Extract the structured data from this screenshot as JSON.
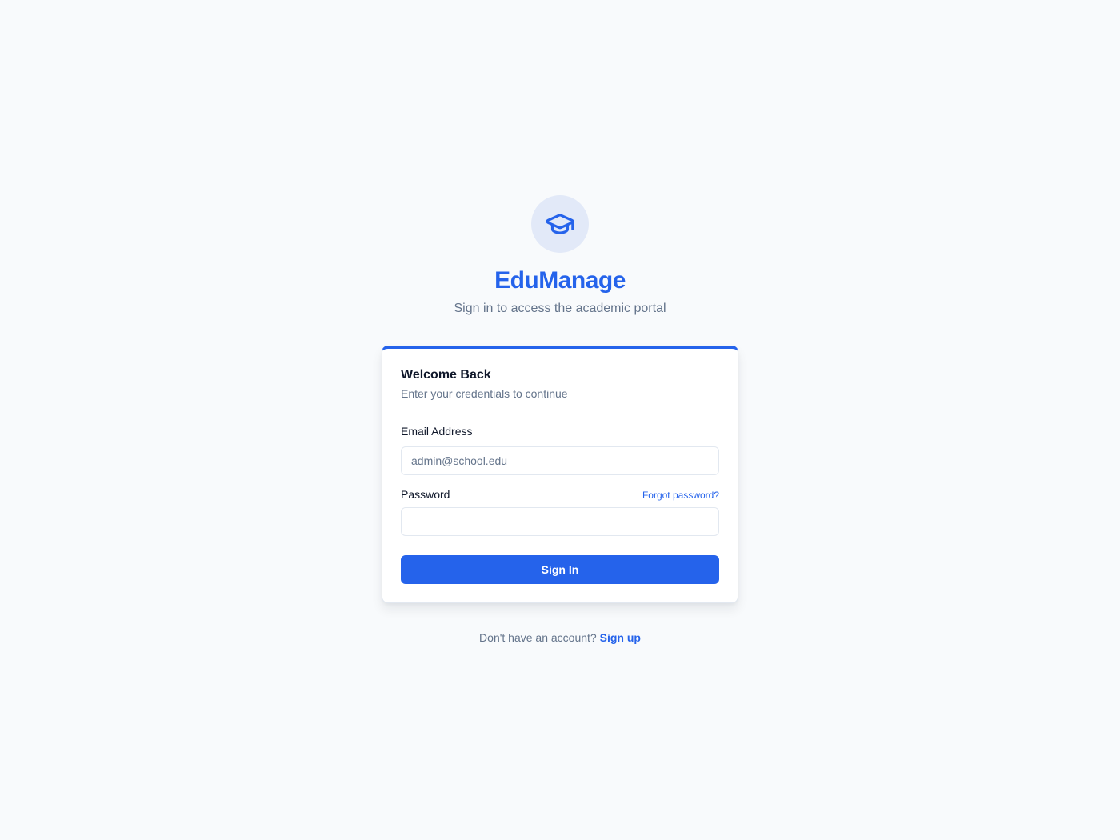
{
  "brand": {
    "icon": "graduation-cap-icon",
    "title": "EduManage",
    "subtitle": "Sign in to access the academic portal"
  },
  "login_card": {
    "heading": "Welcome Back",
    "subheading": "Enter your credentials to continue",
    "email": {
      "label": "Email Address",
      "placeholder": "admin@school.edu",
      "value": ""
    },
    "password": {
      "label": "Password",
      "placeholder": "",
      "value": "",
      "forgot_label": "Forgot password?"
    },
    "submit_label": "Sign In"
  },
  "footer": {
    "prompt": "Don't have an account?",
    "signup_label": "Sign up"
  },
  "colors": {
    "primary": "#2563eb",
    "background": "#f8fafc",
    "muted_text": "#64748b",
    "heading_text": "#0f172a",
    "logo_circle": "#e2e9f8"
  }
}
